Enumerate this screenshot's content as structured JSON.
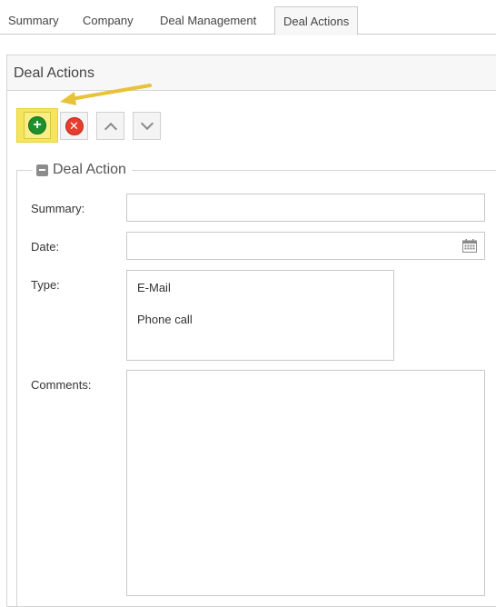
{
  "tabs": [
    {
      "label": "Summary"
    },
    {
      "label": "Company"
    },
    {
      "label": "Deal Management"
    },
    {
      "label": "Deal Actions"
    }
  ],
  "panel": {
    "title": "Deal Actions"
  },
  "toolbar": {
    "add_icon": "plus-circle-icon",
    "delete_icon": "x-circle-icon",
    "up_icon": "chevron-up-icon",
    "down_icon": "chevron-down-icon",
    "add_symbol": "+",
    "delete_symbol": "✕"
  },
  "fieldset": {
    "legend": "Deal Action"
  },
  "form": {
    "summary_label": "Summary:",
    "summary_value": "",
    "date_label": "Date:",
    "date_value": "",
    "type_label": "Type:",
    "type_options": [
      "E-Mail",
      "Phone call"
    ],
    "comments_label": "Comments:",
    "comments_value": ""
  },
  "colors": {
    "highlight": "#f4e55c",
    "arrow": "#e8c237",
    "add_green": "#1f8f2b",
    "delete_red": "#e53e2e"
  }
}
